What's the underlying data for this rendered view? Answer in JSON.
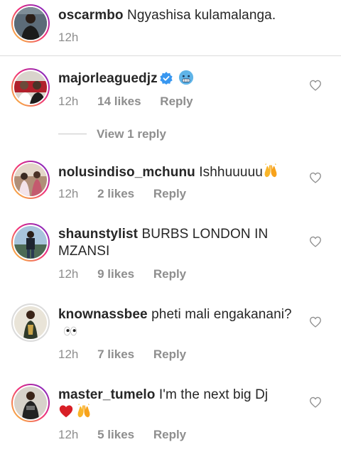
{
  "comments": [
    {
      "username": "oscarmbo",
      "text": "Ngyashisa kulamalanga.",
      "time": "12h",
      "likes": "",
      "reply": "",
      "verified": false,
      "emojis": []
    },
    {
      "username": "majorleaguedjz",
      "text": "",
      "time": "12h",
      "likes": "14 likes",
      "reply": "Reply",
      "verified": true,
      "emojis": [
        "cold-face-emoji"
      ]
    },
    {
      "username": "nolusindiso_mchunu",
      "text": "Ishhuuuuu",
      "time": "12h",
      "likes": "2 likes",
      "reply": "Reply",
      "verified": false,
      "emojis": [
        "raising-hands-emoji"
      ]
    },
    {
      "username": "shaunstylist",
      "text": "BURBS LONDON IN MZANSI",
      "time": "12h",
      "likes": "9 likes",
      "reply": "Reply",
      "verified": false,
      "emojis": []
    },
    {
      "username": "knownassbee",
      "text": "pheti mali engakanani?",
      "time": "12h",
      "likes": "7 likes",
      "reply": "Reply",
      "verified": false,
      "emojis": [
        "eyes-emoji"
      ]
    },
    {
      "username": "master_tumelo",
      "text": "I'm the next big Dj",
      "time": "12h",
      "likes": "5 likes",
      "reply": "Reply",
      "verified": false,
      "emojis": [
        "red-heart-emoji",
        "raising-hands-emoji"
      ]
    }
  ],
  "view_replies": "View 1 reply",
  "colors": {
    "text": "#262626",
    "secondary": "#8e8e8e",
    "verified": "#3897f0",
    "story_ring_start": "#f9ce34",
    "story_ring_end": "#ee2a7b"
  },
  "icons": [
    "heart-outline-icon",
    "verified-badge-icon"
  ]
}
